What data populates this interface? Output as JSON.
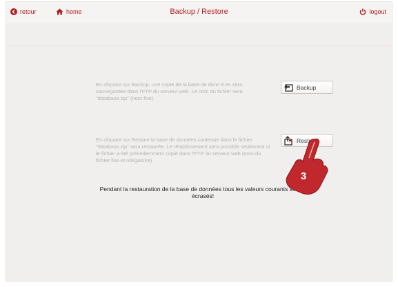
{
  "header": {
    "title": "Backup / Restore",
    "back_label": "retour",
    "home_label": "home",
    "logout_label": "logout"
  },
  "backup": {
    "description": "En cliquant sur Backup, une copie de la base de donn é es sera sauvegardée dans l'FTP du serveur web. Le nom du fichier sera \"database.zip\" (nom fixe)",
    "button_label": "Backup"
  },
  "restore": {
    "description": "En cliquant sur Restore la base de données contenue dans le fichier \"database.zip\" sera restaurée. Le rétablissement sera possible seulement si le fichier a été précédemment copié dans l'FTP du serveur web (nom du fichier fixe et obligatoire)",
    "button_label": "Restore"
  },
  "warning": "Pendant la restauration de la base de données tous les valeurs courants seront écrasés!",
  "callout": {
    "step_number": "3"
  },
  "colors": {
    "accent": "#b02020",
    "panel_bg": "#f1efee",
    "hand": "#c0282d"
  }
}
